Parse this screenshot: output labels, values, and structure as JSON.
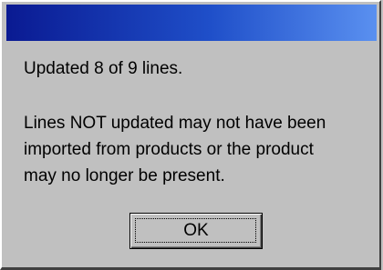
{
  "dialog": {
    "title": "",
    "message_line1": "Updated 8 of 9 lines.",
    "message_line2": "Lines NOT updated may not have been\nimported from products or the product\nmay no longer be present.",
    "ok_label": "OK"
  },
  "colors": {
    "face": "#c0c0c0",
    "titlebar_start": "#0a1a92",
    "titlebar_end": "#5a90f0"
  }
}
